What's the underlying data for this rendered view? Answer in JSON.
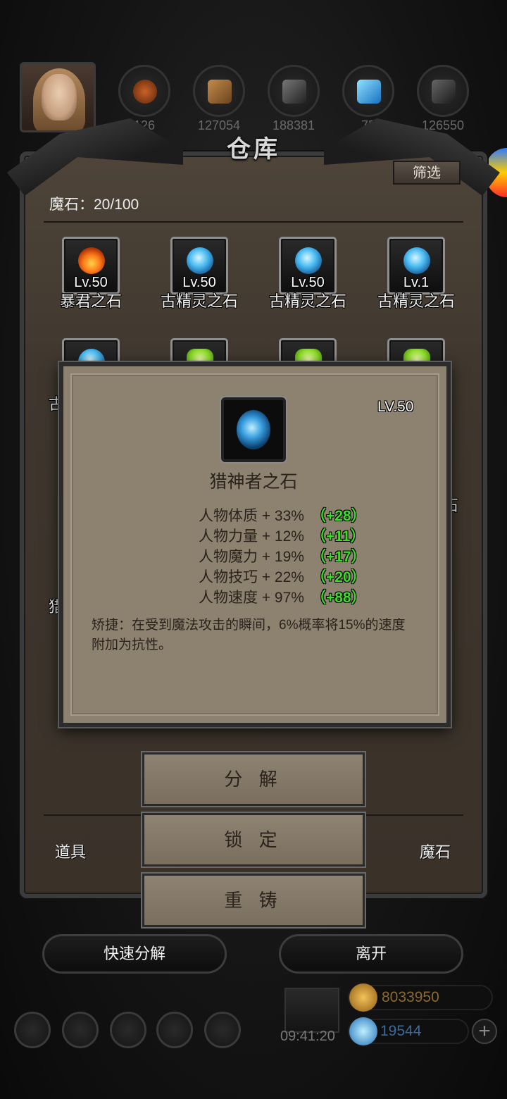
{
  "header": {
    "resources": [
      {
        "icon": "meat-icon",
        "value": "126"
      },
      {
        "icon": "wood-icon",
        "value": "127054"
      },
      {
        "icon": "iron-icon",
        "value": "188381"
      },
      {
        "icon": "crystal-icon",
        "value": "75"
      },
      {
        "icon": "stone-icon",
        "value": "126550"
      }
    ]
  },
  "warehouse": {
    "title": "仓库",
    "filter_label": "筛选",
    "count_label": "魔石：20/100",
    "items": [
      {
        "name": "暴君之石",
        "level": "Lv.50",
        "gem": "fire"
      },
      {
        "name": "古精灵之石",
        "level": "Lv.50",
        "gem": "blue"
      },
      {
        "name": "古精灵之石",
        "level": "Lv.50",
        "gem": "blue"
      },
      {
        "name": "古精灵之石",
        "level": "Lv.1",
        "gem": "blue"
      }
    ],
    "partial_left_1": "古",
    "partial_right_1": "石",
    "partial_left_2": "猎",
    "tabs": {
      "left": "道具",
      "right": "魔石"
    }
  },
  "popup": {
    "level": "LV.50",
    "name": "猎神者之石",
    "stats": [
      {
        "label": "人物体质 + 33%",
        "bonus": "（+28）"
      },
      {
        "label": "人物力量 + 12%",
        "bonus": "（+11）"
      },
      {
        "label": "人物魔力 + 19%",
        "bonus": "（+17）"
      },
      {
        "label": "人物技巧 + 22%",
        "bonus": "（+20）"
      },
      {
        "label": "人物速度 + 97%",
        "bonus": "（+88）"
      }
    ],
    "description": "矫捷：在受到魔法攻击的瞬间，6%概率将15%的速度附加为抗性。"
  },
  "menu": {
    "decompose": "分 解",
    "lock": "锁 定",
    "recast": "重 铸"
  },
  "footer": {
    "quick_decompose": "快速分解",
    "leave": "离开",
    "timer": "09:41:20",
    "gold": "8033950",
    "diamonds": "19544",
    "plus": "+"
  },
  "colors": {
    "bonus_green": "#3ddc27",
    "panel": "#8d8170",
    "frame": "#3a3229"
  }
}
